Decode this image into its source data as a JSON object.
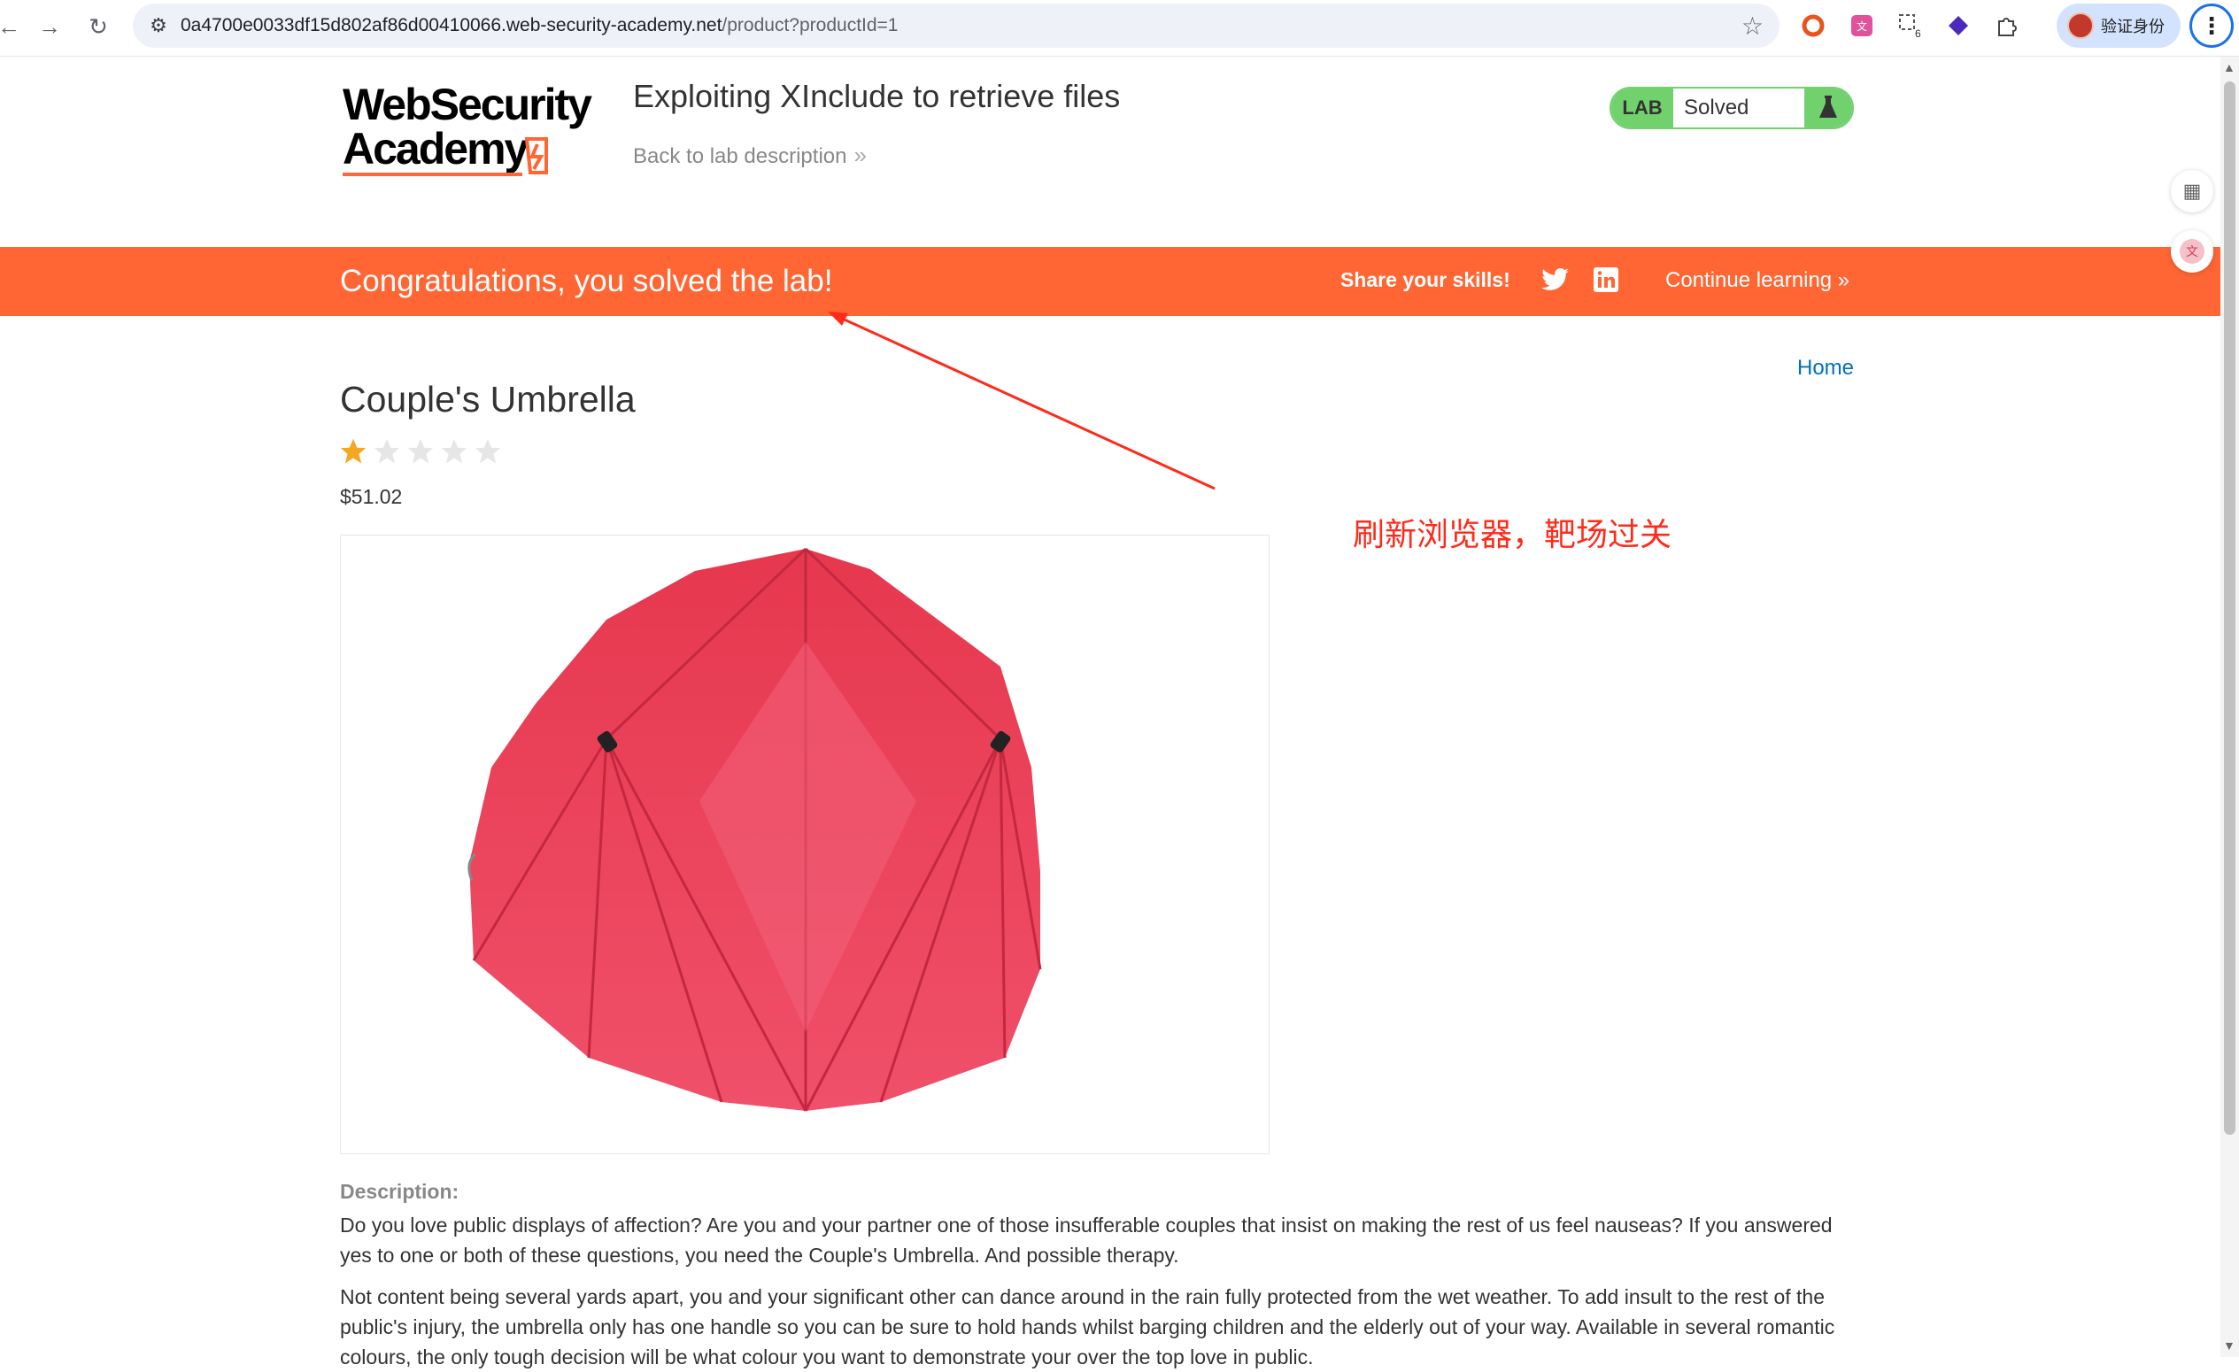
{
  "browser": {
    "url_host": "0a4700e0033df15d802af86d00410066.web-security-academy.net",
    "url_path": "/product?productId=1",
    "profile_label": "验证身份",
    "extension_badge": "6"
  },
  "header": {
    "logo_line1": "WebSecurity",
    "logo_line2": "Academy",
    "lab_title": "Exploiting XInclude to retrieve files",
    "back_link": "Back to lab description",
    "status_tag": "LAB",
    "status_text": "Solved"
  },
  "banner": {
    "message": "Congratulations, you solved the lab!",
    "share_label": "Share your skills!",
    "continue_label": "Continue learning"
  },
  "product": {
    "home_link": "Home",
    "title": "Couple's Umbrella",
    "rating": 1,
    "rating_max": 5,
    "price": "$51.02",
    "description_label": "Description:",
    "description_p1": "Do you love public displays of affection? Are you and your partner one of those insufferable couples that insist on making the rest of us feel nauseas? If you answered yes to one or both of these questions, you need the Couple's Umbrella. And possible therapy.",
    "description_p2": "Not content being several yards apart, you and your significant other can dance around in the rain fully protected from the wet weather. To add insult to the rest of the public's injury, the umbrella only has one handle so you can be sure to hold hands whilst barging children and the elderly out of your way. Available in several romantic colours, the only tough decision will be what colour you want to demonstrate your over the top love in public."
  },
  "annotation": {
    "text": "刷新浏览器，靶场过关"
  },
  "colors": {
    "banner": "#ff6633",
    "lab_green": "#70d16d",
    "link_blue": "#0071bc",
    "annotation_red": "#ff2a1a",
    "star_gold": "#f5a623"
  }
}
